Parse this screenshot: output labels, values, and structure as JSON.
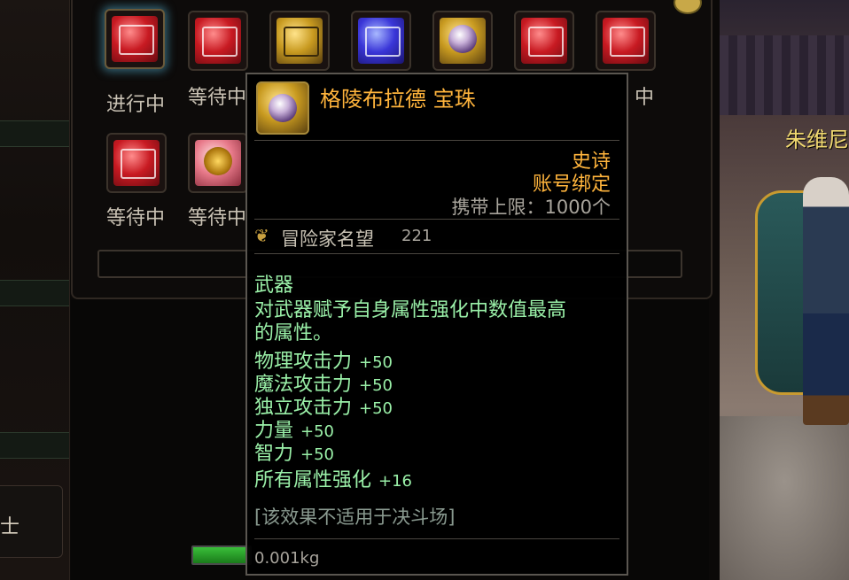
{
  "slots_row1": [
    {
      "icon": "red-giftbox-icon",
      "label": "进行中"
    },
    {
      "icon": "red-giftbox-icon",
      "label": "等待中"
    },
    {
      "icon": "gold-chest-icon",
      "label": ""
    },
    {
      "icon": "blue-giftbox-icon",
      "label": ""
    },
    {
      "icon": "gold-orb-icon",
      "label": ""
    },
    {
      "icon": "red-giftbox-icon",
      "label": ""
    },
    {
      "icon": "red-giftbox-icon",
      "label": "中"
    }
  ],
  "slots_row2": [
    {
      "icon": "red-giftbox-icon",
      "label": "等待中"
    },
    {
      "icon": "pink-scroll-icon",
      "label": "等待中"
    }
  ],
  "left_panel": {
    "label": "士"
  },
  "npc": {
    "name": "朱维尼"
  },
  "tooltip": {
    "title": "格陵布拉德 宝珠",
    "rarity": "史诗",
    "bind": "账号绑定",
    "carry_limit": "携带上限：1000个",
    "reputation_label": "冒险家名望",
    "reputation_value": "221",
    "description": [
      "武器",
      "对武器赋予自身属性强化中数值最高",
      "的属性。"
    ],
    "stats": [
      {
        "name": "物理攻击力",
        "value": "+50"
      },
      {
        "name": "魔法攻击力",
        "value": "+50"
      },
      {
        "name": "独立攻击力",
        "value": "+50"
      },
      {
        "name": "力量",
        "value": "+50"
      },
      {
        "name": "智力",
        "value": "+50"
      },
      {
        "name": "所有属性强化",
        "value": "+16"
      }
    ],
    "note": "[该效果不适用于决斗场]",
    "weight": "0.001kg"
  },
  "colors": {
    "rarity": "#ffb43c",
    "effect_text": "#9af0a8",
    "title": "#ffb43c"
  }
}
